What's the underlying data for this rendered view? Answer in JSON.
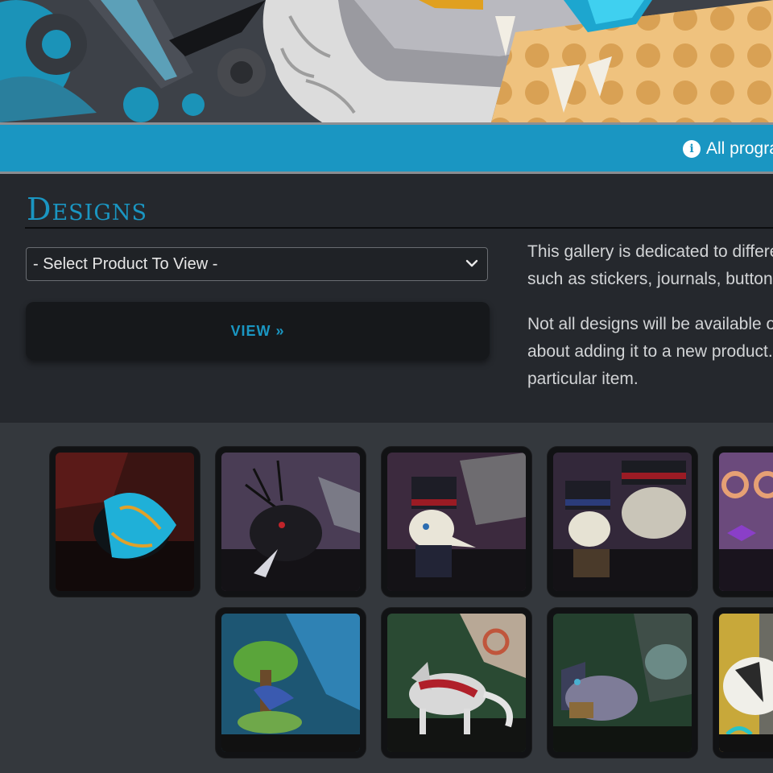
{
  "banner": {
    "alt": "character banner art"
  },
  "notice": {
    "text": "All progra"
  },
  "designs": {
    "title": "Designs",
    "select_value": "- Select Product To View -",
    "view_label": "VIEW",
    "view_arrows": "»",
    "description": [
      "This gallery is dedicated to differe",
      "such as stickers, journals, button",
      "Not all designs will be available o",
      "about adding it to a new product.",
      "particular item."
    ]
  },
  "gallery": {
    "tiles": [
      {
        "name": "design-tile-1",
        "bg": "#3a1412",
        "accent": "#1fb0d8"
      },
      {
        "name": "design-tile-2",
        "bg": "#4a3d55",
        "accent": "#1a1a1e"
      },
      {
        "name": "design-tile-3",
        "bg": "#3c2a3e",
        "accent": "#e9e5d8"
      },
      {
        "name": "design-tile-4",
        "bg": "#33283a",
        "accent": "#e6e2d3"
      },
      {
        "name": "design-tile-5",
        "bg": "#6b4a7c",
        "accent": "#c792d8"
      },
      {
        "name": "design-tile-6",
        "bg": "#1d5673",
        "accent": "#5aa53a"
      },
      {
        "name": "design-tile-7",
        "bg": "#2a4a33",
        "accent": "#c8c8c8"
      },
      {
        "name": "design-tile-8",
        "bg": "#24402e",
        "accent": "#7e7c98"
      },
      {
        "name": "design-tile-9",
        "bg": "#6b6b63",
        "accent": "#f0efe9"
      }
    ]
  },
  "colors": {
    "accent": "#1a96c2",
    "panel": "#25282d",
    "gallery": "#34383d"
  }
}
